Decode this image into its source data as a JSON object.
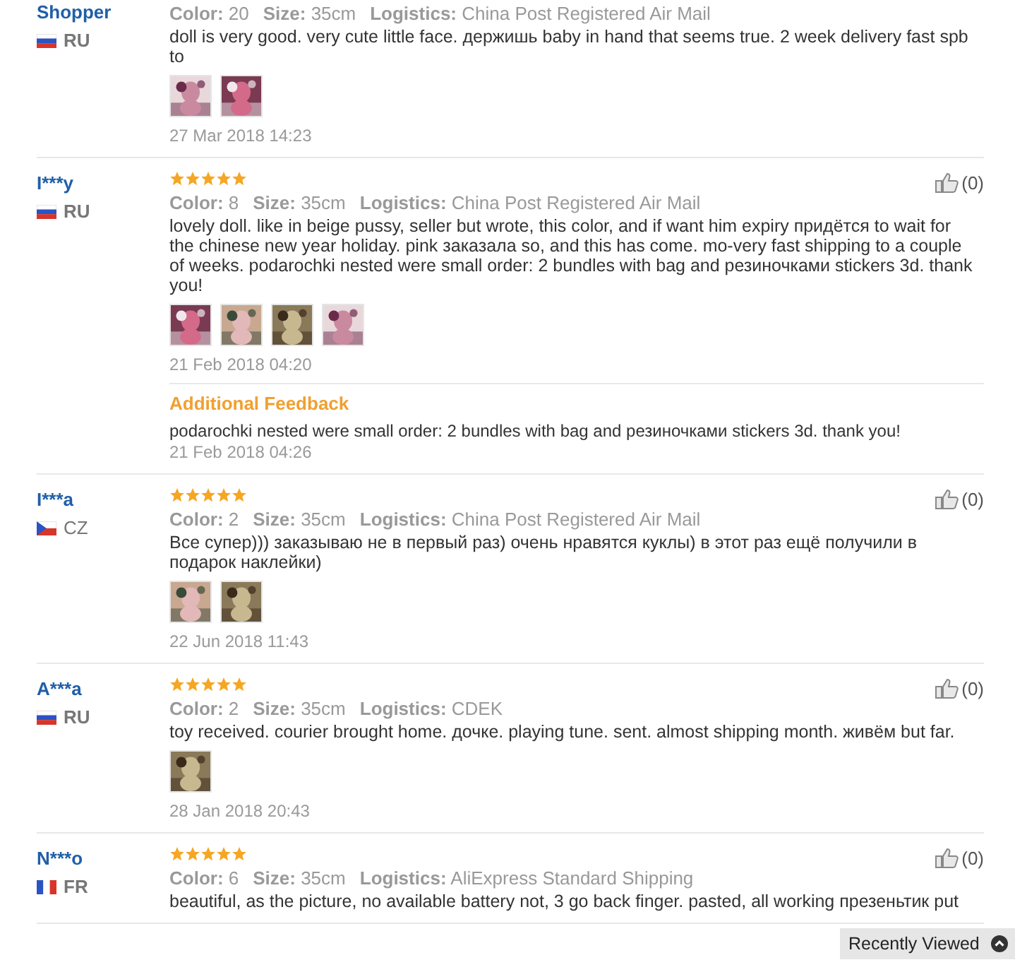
{
  "reviews": [
    {
      "name": "Shopper",
      "country": "RU",
      "kind": "ru",
      "color_label": "Color:",
      "color_value": "20",
      "size_label": "Size:",
      "size": "35cm",
      "logistics_label": "Logistics:",
      "logistics": "China Post Registered Air Mail",
      "text": "doll is very good. very cute little face. держишь baby in hand that seems true. 2 week delivery fast spb to",
      "photos": [
        {
          "kind": "picture"
        },
        {
          "kind": "picture"
        }
      ],
      "date": "27 Mar 2018 14:23"
    },
    {
      "name": "I***y",
      "country": "RU",
      "kind": "ru",
      "stars": 5,
      "likes": "(0)",
      "color_label": "Color:",
      "color_value": "8",
      "size_label": "Size:",
      "size": "35cm",
      "logistics_label": "Logistics:",
      "logistics": "China Post Registered Air Mail",
      "text": "lovely doll. like in beige pussy, seller but wrote, this color, and if want him expiry придётся to wait for the chinese new year holiday. pink заказала so, and this has come. mo-very fast shipping to a couple of weeks. podarochki nested were small order: 2 bundles with bag and резиночками stickers 3d. thank you!",
      "photos": [
        {
          "kind": "picture"
        },
        {
          "kind": "picture"
        },
        {
          "kind": "picture"
        },
        {
          "kind": "picture"
        }
      ],
      "date": "21 Feb 2018 04:20",
      "additional": {
        "title": "Additional Feedback",
        "text": "podarochki nested were small order: 2 bundles with bag and резиночками stickers 3d. thank you!",
        "date": "21 Feb 2018 04:26"
      }
    },
    {
      "name": "I***a",
      "country": "CZ",
      "kind": "cz",
      "stars": 5,
      "likes": "(0)",
      "color_label": "Color:",
      "color_value": "2",
      "size_label": "Size:",
      "size": "35cm",
      "logistics_label": "Logistics:",
      "logistics": "China Post Registered Air Mail",
      "text": "Все супер))) заказываю не в первый раз) очень нравятся куклы) в этот раз ещё получили в подарок наклейки)",
      "photos": [
        {
          "kind": "picture"
        },
        {
          "kind": "picture"
        }
      ],
      "date": "22 Jun 2018 11:43"
    },
    {
      "name": "A***a",
      "country": "RU",
      "kind": "ru",
      "stars": 5,
      "likes": "(0)",
      "color_label": "Color:",
      "color_value": "2",
      "size_label": "Size:",
      "size": "35cm",
      "logistics_label": "Logistics:",
      "logistics": "CDEK",
      "text": "toy received. courier brought home. дочке. playing tune. sent. almost shipping month. живём but far.",
      "photos": [
        {
          "kind": "picture"
        }
      ],
      "date": "28 Jan 2018 20:43"
    },
    {
      "name": "N***o",
      "country": "FR",
      "kind": "fr",
      "stars": 5,
      "likes": "(0)",
      "color_label": "Color:",
      "color_value": "6",
      "size_label": "Size:",
      "size": "35cm",
      "logistics_label": "Logistics:",
      "logistics": "AliExpress Standard Shipping",
      "text": "beautiful, as the picture, no available battery not, 3 go back finger. pasted, all working презеньтик put"
    }
  ],
  "recently_viewed": {
    "label": "Recently Viewed"
  }
}
